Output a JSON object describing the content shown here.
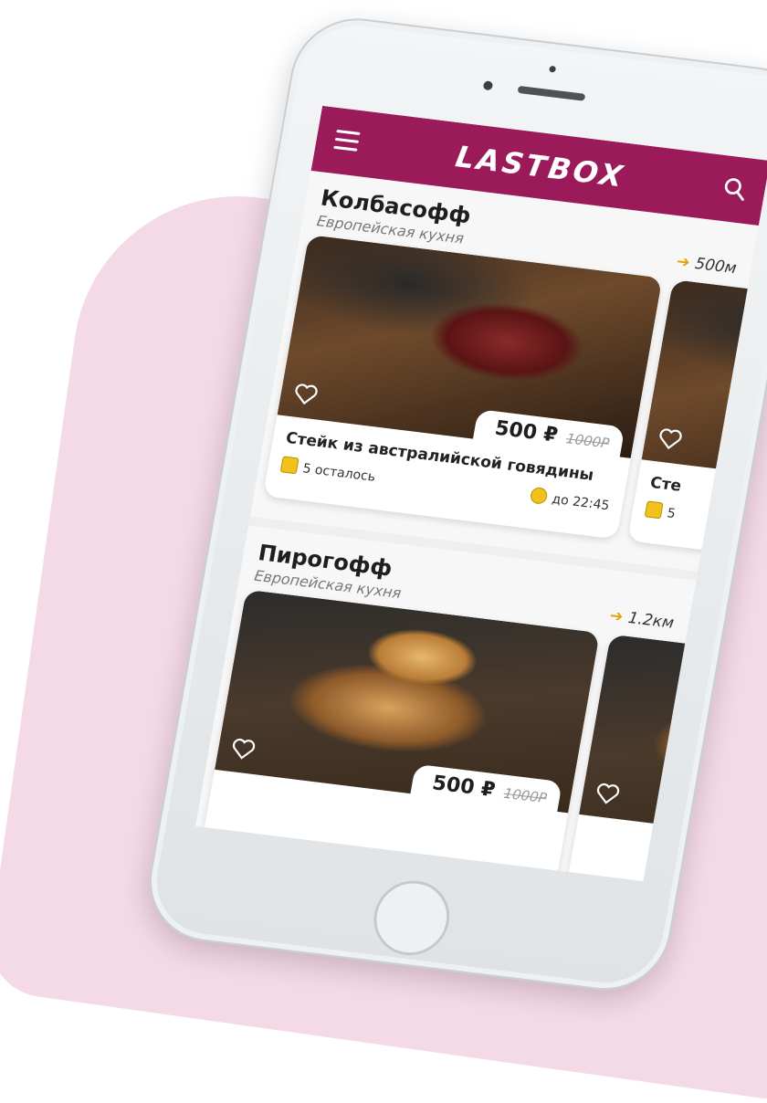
{
  "header": {
    "logo": "LASTBOX"
  },
  "restaurants": [
    {
      "name": "Колбасофф",
      "cuisine": "Европейская кухня",
      "distance": "500м",
      "card": {
        "price": "500 ₽",
        "old_price": "1000Р",
        "dish": "Стейк из австралийской говядины",
        "remaining": "5 осталось",
        "until": "до 22:45"
      },
      "peek_dish": "Сте",
      "peek_remaining": "5"
    },
    {
      "name": "Пирогофф",
      "cuisine": "Европейская кухня",
      "distance": "1.2км",
      "card": {
        "price": "500 ₽",
        "old_price": "1000Р"
      }
    }
  ],
  "colors": {
    "brand": "#9b1b5a",
    "accent": "#f1c21b",
    "background_blob": "#f4d9e6"
  }
}
